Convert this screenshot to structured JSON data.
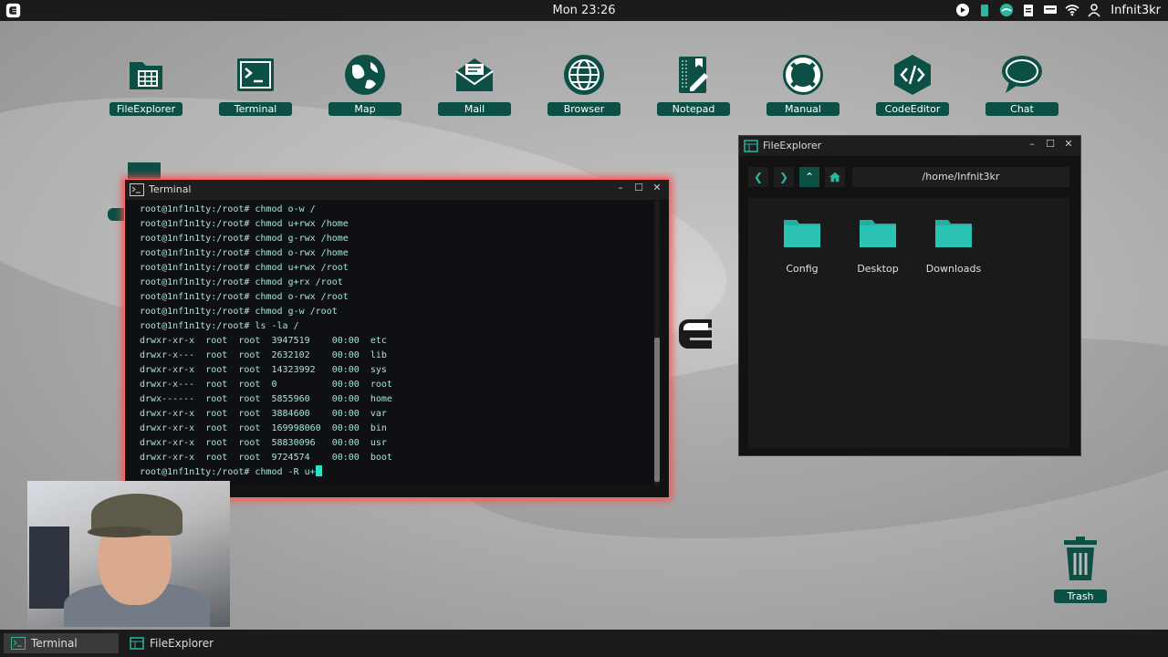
{
  "topbar": {
    "clock": "Mon 23:26",
    "username": "Infnit3kr"
  },
  "desktop_icons": [
    {
      "label": "FileExplorer",
      "icon": "file-explorer-icon"
    },
    {
      "label": "Terminal",
      "icon": "terminal-icon"
    },
    {
      "label": "Map",
      "icon": "globe-map-icon"
    },
    {
      "label": "Mail",
      "icon": "mail-icon"
    },
    {
      "label": "Browser",
      "icon": "browser-globe-icon"
    },
    {
      "label": "Notepad",
      "icon": "notepad-icon"
    },
    {
      "label": "Manual",
      "icon": "lifebuoy-icon"
    },
    {
      "label": "CodeEditor",
      "icon": "code-editor-icon"
    },
    {
      "label": "Chat",
      "icon": "chat-bubble-icon"
    }
  ],
  "terminal": {
    "title": "Terminal",
    "lines": [
      "root@1nf1n1ty:/root# chmod o-w /",
      "root@1nf1n1ty:/root# chmod u+rwx /home",
      "root@1nf1n1ty:/root# chmod g-rwx /home",
      "root@1nf1n1ty:/root# chmod o-rwx /home",
      "root@1nf1n1ty:/root# chmod u+rwx /root",
      "root@1nf1n1ty:/root# chmod g+rx /root",
      "root@1nf1n1ty:/root# chmod o-rwx /root",
      "root@1nf1n1ty:/root# chmod g-w /root",
      "root@1nf1n1ty:/root# ls -la /",
      "drwxr-xr-x  root  root  3947519    00:00  etc",
      "drwxr-x---  root  root  2632102    00:00  lib",
      "drwxr-xr-x  root  root  14323992   00:00  sys",
      "drwxr-x---  root  root  0          00:00  root",
      "drwx------  root  root  5855960    00:00  home",
      "drwxr-xr-x  root  root  3884600    00:00  var",
      "drwxr-xr-x  root  root  169998060  00:00  bin",
      "drwxr-xr-x  root  root  58830096   00:00  usr",
      "drwxr-xr-x  root  root  9724574    00:00  boot"
    ],
    "current_input": "root@1nf1n1ty:/root# chmod -R u+"
  },
  "file_explorer": {
    "title": "FileExplorer",
    "path": "/home/Infnit3kr",
    "folders": [
      "Config",
      "Desktop",
      "Downloads"
    ]
  },
  "trash": {
    "label": "Trash"
  },
  "taskbar": [
    {
      "label": "Terminal",
      "active": true
    },
    {
      "label": "FileExplorer",
      "active": false
    }
  ],
  "colors": {
    "accent": "#0c4f44",
    "teal": "#2ab6a0",
    "terminal_glow": "#ff4a4a"
  }
}
